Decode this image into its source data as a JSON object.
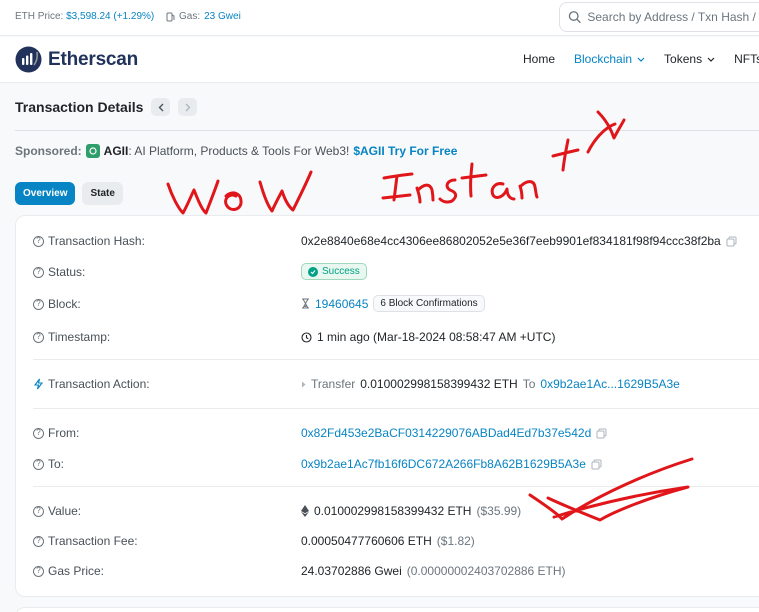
{
  "topbar": {
    "eth_price_label": "ETH Price:",
    "eth_price_value": "$3,598.24 (+1.29%)",
    "gas_label": "Gas:",
    "gas_value": "23 Gwei",
    "search_placeholder": "Search by Address / Txn Hash / Block / Token / Domain Name"
  },
  "navbar": {
    "brand": "Etherscan",
    "items": [
      {
        "label": "Home",
        "active": false,
        "dropdown": false
      },
      {
        "label": "Blockchain",
        "active": true,
        "dropdown": true
      },
      {
        "label": "Tokens",
        "active": false,
        "dropdown": true
      },
      {
        "label": "NFTs",
        "active": false,
        "dropdown": false
      }
    ]
  },
  "page": {
    "title": "Transaction Details"
  },
  "sponsored": {
    "label": "Sponsored:",
    "brand": "AGII",
    "text": ": AI Platform, Products & Tools For Web3!",
    "cta": "$AGII Try For Free"
  },
  "tabs": [
    {
      "label": "Overview",
      "active": true
    },
    {
      "label": "State",
      "active": false
    }
  ],
  "details": {
    "hash_label": "Transaction Hash:",
    "hash_value": "0x2e8840e68e4cc4306ee86802052e5e36f7eeb9901ef834181f98f94ccc38f2ba",
    "status_label": "Status:",
    "status_value": "Success",
    "block_label": "Block:",
    "block_value": "19460645",
    "block_confirmations": "6 Block Confirmations",
    "timestamp_label": "Timestamp:",
    "timestamp_value": "1 min ago (Mar-18-2024 08:58:47 AM +UTC)",
    "action_label": "Transaction Action:",
    "action_prefix": "Transfer",
    "action_amount": "0.010002998158399432 ETH",
    "action_to_word": "To",
    "action_to_address": "0x9b2ae1Ac...1629B5A3e",
    "from_label": "From:",
    "from_value": "0x82Fd453e2BaCF0314229076ABDad4Ed7b37e542d",
    "to_label": "To:",
    "to_value": "0x9b2ae1Ac7fb16f6DC672A266Fb8A62B1629B5A3e",
    "value_label": "Value:",
    "value_eth": "0.010002998158399432 ETH",
    "value_usd": "($35.99)",
    "fee_label": "Transaction Fee:",
    "fee_value": "0.00050477760606 ETH",
    "fee_usd": "($1.82)",
    "gasprice_label": "Gas Price:",
    "gasprice_value": "24.03702886 Gwei",
    "gasprice_eth": "(0.00000002403702886 ETH)"
  },
  "annotations": {
    "handwriting_1": "WoW",
    "handwriting_2": "Instant",
    "stroke_color": "#e0161b"
  }
}
